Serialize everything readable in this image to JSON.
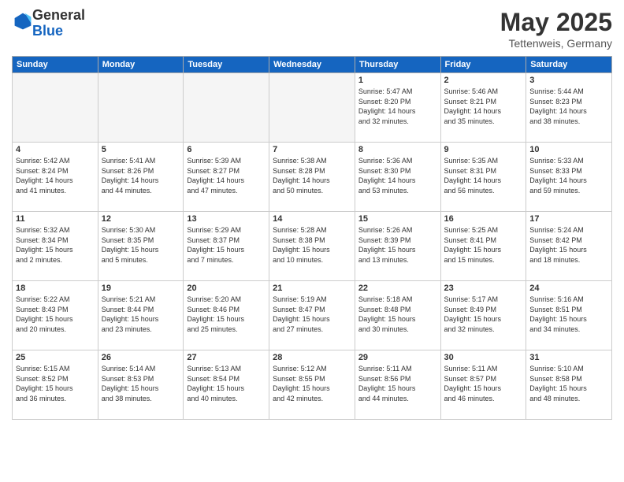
{
  "logo": {
    "general": "General",
    "blue": "Blue"
  },
  "header": {
    "month": "May 2025",
    "location": "Tettenweis, Germany"
  },
  "days_of_week": [
    "Sunday",
    "Monday",
    "Tuesday",
    "Wednesday",
    "Thursday",
    "Friday",
    "Saturday"
  ],
  "weeks": [
    [
      {
        "day": "",
        "info": ""
      },
      {
        "day": "",
        "info": ""
      },
      {
        "day": "",
        "info": ""
      },
      {
        "day": "",
        "info": ""
      },
      {
        "day": "1",
        "info": "Sunrise: 5:47 AM\nSunset: 8:20 PM\nDaylight: 14 hours\nand 32 minutes."
      },
      {
        "day": "2",
        "info": "Sunrise: 5:46 AM\nSunset: 8:21 PM\nDaylight: 14 hours\nand 35 minutes."
      },
      {
        "day": "3",
        "info": "Sunrise: 5:44 AM\nSunset: 8:23 PM\nDaylight: 14 hours\nand 38 minutes."
      }
    ],
    [
      {
        "day": "4",
        "info": "Sunrise: 5:42 AM\nSunset: 8:24 PM\nDaylight: 14 hours\nand 41 minutes."
      },
      {
        "day": "5",
        "info": "Sunrise: 5:41 AM\nSunset: 8:26 PM\nDaylight: 14 hours\nand 44 minutes."
      },
      {
        "day": "6",
        "info": "Sunrise: 5:39 AM\nSunset: 8:27 PM\nDaylight: 14 hours\nand 47 minutes."
      },
      {
        "day": "7",
        "info": "Sunrise: 5:38 AM\nSunset: 8:28 PM\nDaylight: 14 hours\nand 50 minutes."
      },
      {
        "day": "8",
        "info": "Sunrise: 5:36 AM\nSunset: 8:30 PM\nDaylight: 14 hours\nand 53 minutes."
      },
      {
        "day": "9",
        "info": "Sunrise: 5:35 AM\nSunset: 8:31 PM\nDaylight: 14 hours\nand 56 minutes."
      },
      {
        "day": "10",
        "info": "Sunrise: 5:33 AM\nSunset: 8:33 PM\nDaylight: 14 hours\nand 59 minutes."
      }
    ],
    [
      {
        "day": "11",
        "info": "Sunrise: 5:32 AM\nSunset: 8:34 PM\nDaylight: 15 hours\nand 2 minutes."
      },
      {
        "day": "12",
        "info": "Sunrise: 5:30 AM\nSunset: 8:35 PM\nDaylight: 15 hours\nand 5 minutes."
      },
      {
        "day": "13",
        "info": "Sunrise: 5:29 AM\nSunset: 8:37 PM\nDaylight: 15 hours\nand 7 minutes."
      },
      {
        "day": "14",
        "info": "Sunrise: 5:28 AM\nSunset: 8:38 PM\nDaylight: 15 hours\nand 10 minutes."
      },
      {
        "day": "15",
        "info": "Sunrise: 5:26 AM\nSunset: 8:39 PM\nDaylight: 15 hours\nand 13 minutes."
      },
      {
        "day": "16",
        "info": "Sunrise: 5:25 AM\nSunset: 8:41 PM\nDaylight: 15 hours\nand 15 minutes."
      },
      {
        "day": "17",
        "info": "Sunrise: 5:24 AM\nSunset: 8:42 PM\nDaylight: 15 hours\nand 18 minutes."
      }
    ],
    [
      {
        "day": "18",
        "info": "Sunrise: 5:22 AM\nSunset: 8:43 PM\nDaylight: 15 hours\nand 20 minutes."
      },
      {
        "day": "19",
        "info": "Sunrise: 5:21 AM\nSunset: 8:44 PM\nDaylight: 15 hours\nand 23 minutes."
      },
      {
        "day": "20",
        "info": "Sunrise: 5:20 AM\nSunset: 8:46 PM\nDaylight: 15 hours\nand 25 minutes."
      },
      {
        "day": "21",
        "info": "Sunrise: 5:19 AM\nSunset: 8:47 PM\nDaylight: 15 hours\nand 27 minutes."
      },
      {
        "day": "22",
        "info": "Sunrise: 5:18 AM\nSunset: 8:48 PM\nDaylight: 15 hours\nand 30 minutes."
      },
      {
        "day": "23",
        "info": "Sunrise: 5:17 AM\nSunset: 8:49 PM\nDaylight: 15 hours\nand 32 minutes."
      },
      {
        "day": "24",
        "info": "Sunrise: 5:16 AM\nSunset: 8:51 PM\nDaylight: 15 hours\nand 34 minutes."
      }
    ],
    [
      {
        "day": "25",
        "info": "Sunrise: 5:15 AM\nSunset: 8:52 PM\nDaylight: 15 hours\nand 36 minutes."
      },
      {
        "day": "26",
        "info": "Sunrise: 5:14 AM\nSunset: 8:53 PM\nDaylight: 15 hours\nand 38 minutes."
      },
      {
        "day": "27",
        "info": "Sunrise: 5:13 AM\nSunset: 8:54 PM\nDaylight: 15 hours\nand 40 minutes."
      },
      {
        "day": "28",
        "info": "Sunrise: 5:12 AM\nSunset: 8:55 PM\nDaylight: 15 hours\nand 42 minutes."
      },
      {
        "day": "29",
        "info": "Sunrise: 5:11 AM\nSunset: 8:56 PM\nDaylight: 15 hours\nand 44 minutes."
      },
      {
        "day": "30",
        "info": "Sunrise: 5:11 AM\nSunset: 8:57 PM\nDaylight: 15 hours\nand 46 minutes."
      },
      {
        "day": "31",
        "info": "Sunrise: 5:10 AM\nSunset: 8:58 PM\nDaylight: 15 hours\nand 48 minutes."
      }
    ]
  ]
}
